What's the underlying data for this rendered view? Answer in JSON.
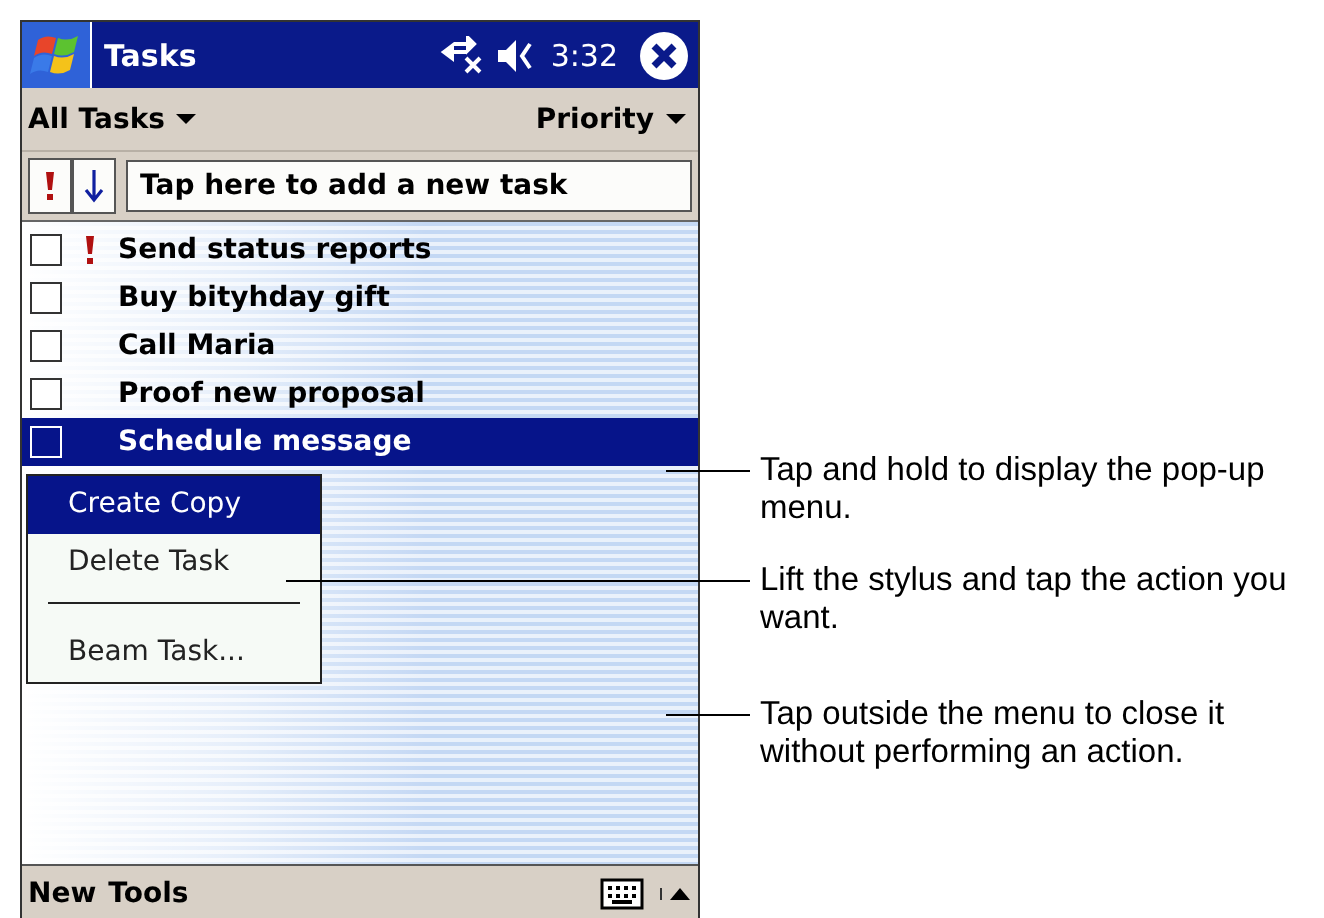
{
  "title_bar": {
    "title": "Tasks",
    "time": "3:32"
  },
  "toolbar": {
    "filter": "All Tasks",
    "sort": "Priority"
  },
  "entry_bar": {
    "placeholder": "Tap here to add a new task"
  },
  "tasks": [
    {
      "title": "Send status reports",
      "checked": false,
      "high_priority": true,
      "selected": false
    },
    {
      "title": "Buy bityhday gift",
      "checked": false,
      "high_priority": false,
      "selected": false
    },
    {
      "title": "Call Maria",
      "checked": false,
      "high_priority": false,
      "selected": false
    },
    {
      "title": "Proof new proposal",
      "checked": false,
      "high_priority": false,
      "selected": false
    },
    {
      "title": "Schedule message",
      "checked": false,
      "high_priority": false,
      "selected": true
    }
  ],
  "context_menu": {
    "items": [
      {
        "kind": "item",
        "label": "Create Copy",
        "selected": true
      },
      {
        "kind": "item",
        "label": "Delete Task",
        "selected": false
      },
      {
        "kind": "separator"
      },
      {
        "kind": "item",
        "label": "Beam Task...",
        "selected": false
      }
    ]
  },
  "command_bar": {
    "menus": [
      "New",
      "Tools"
    ]
  },
  "callouts": [
    {
      "text": "Tap and hold to display the pop-up menu."
    },
    {
      "text": "Lift the stylus and tap the action you want."
    },
    {
      "text": "Tap outside the menu to close it without performing an action."
    }
  ]
}
